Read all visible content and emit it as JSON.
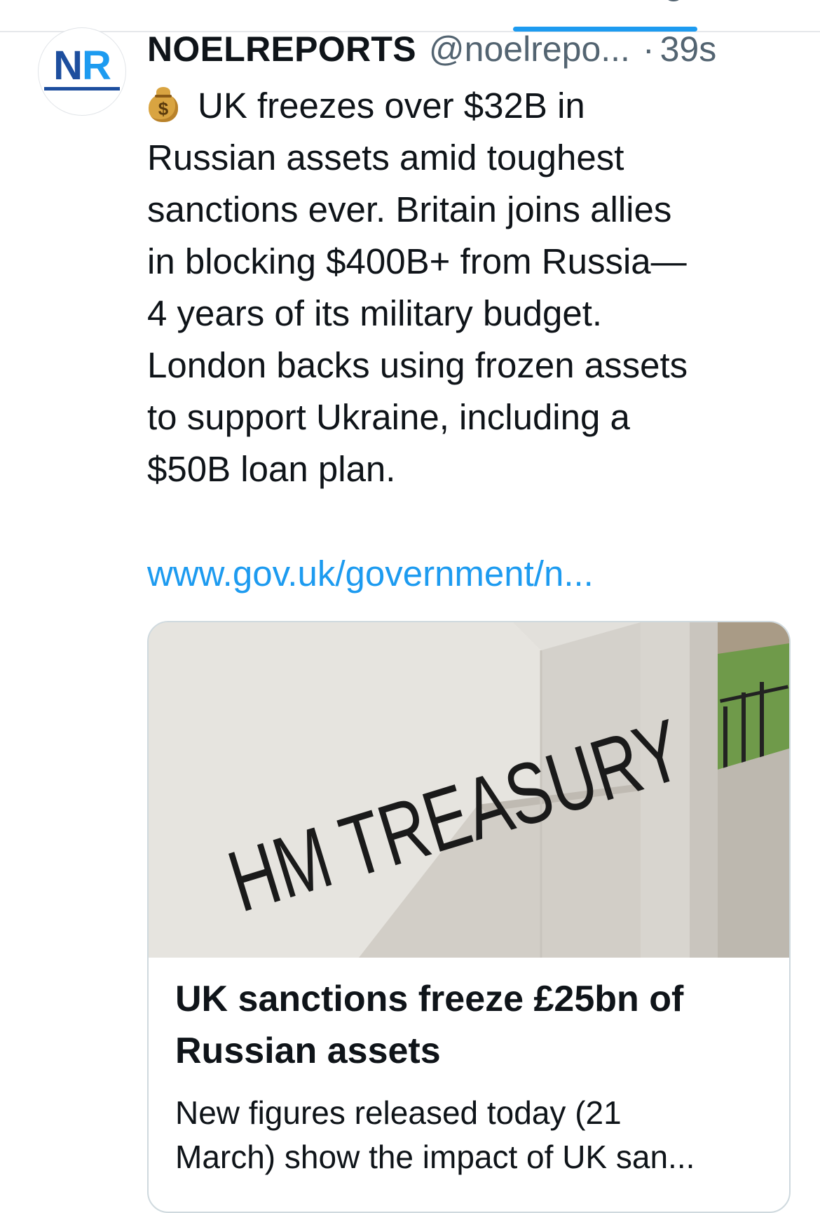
{
  "tweet": {
    "display_name": "NOELREPORTS",
    "handle": "@noelrepo...",
    "separator": "·",
    "timestamp": "39s",
    "avatar_text": {
      "n": "N",
      "r": "R"
    },
    "text_lines": [
      "UK freezes over $32B in",
      "Russian assets amid toughest",
      "sanctions ever. Britain joins allies",
      "in blocking $400B+ from Russia—",
      "4 years of its military budget.",
      "London backs using frozen assets",
      "to support Ukraine, including a",
      "$50B loan plan."
    ],
    "emoji": "money-bag",
    "emoji_symbol": "$",
    "link_text": "www.gov.uk/government/n..."
  },
  "card": {
    "image_sign_text": "HM TREASURY",
    "title_lines": [
      "UK sanctions freeze £25bn of",
      "Russian assets"
    ],
    "description_lines": [
      "New figures released today (21",
      "March) show the impact of UK san..."
    ]
  },
  "colors": {
    "link": "#1d9bf0",
    "secondary_text": "#536471",
    "text": "#0f1419",
    "tab_indicator": "#1d9bf0"
  }
}
